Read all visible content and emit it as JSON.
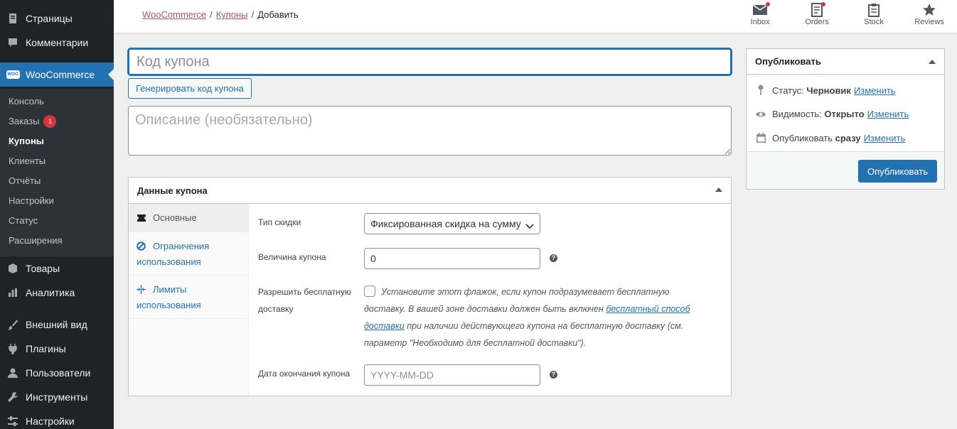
{
  "sidebar": {
    "top_items": [
      {
        "label": "Страницы",
        "icon": "pages-icon"
      },
      {
        "label": "Комментарии",
        "icon": "comments-icon"
      }
    ],
    "woo": {
      "label": "WooCommerce",
      "icon_text": "WOO"
    },
    "submenu": [
      {
        "label": "Консоль"
      },
      {
        "label": "Заказы",
        "badge": "1"
      },
      {
        "label": "Купоны"
      },
      {
        "label": "Клиенты"
      },
      {
        "label": "Отчёты"
      },
      {
        "label": "Настройки"
      },
      {
        "label": "Статус"
      },
      {
        "label": "Расширения"
      }
    ],
    "bottom_items": [
      {
        "label": "Товары"
      },
      {
        "label": "Аналитика"
      },
      {
        "label": "Внешний вид"
      },
      {
        "label": "Плагины"
      },
      {
        "label": "Пользователи"
      },
      {
        "label": "Инструменты"
      },
      {
        "label": "Настройки"
      }
    ]
  },
  "header": {
    "breadcrumb": [
      "WooCommerce",
      "Купоны",
      "Добавить"
    ],
    "activity": [
      "Inbox",
      "Orders",
      "Stock",
      "Reviews"
    ]
  },
  "coupon": {
    "code_placeholder": "Код купона",
    "generate_label": "Генерировать код купона",
    "desc_placeholder": "Описание (необязательно)"
  },
  "coupon_data": {
    "title": "Данные купона",
    "tabs": [
      "Основные",
      "Ограничения использования",
      "Лимиты использования"
    ],
    "discount_type_label": "Тип скидки",
    "discount_type_value": "Фиксированная скидка на сумму",
    "amount_label": "Величина купона",
    "amount_value": "0",
    "free_shipping_label": "Разрешить бесплатную доставку",
    "free_shipping_text_1": "Установите этот флажок, если купон подразумевает бесплатную доставку. В вашей зоне доставки должен быть включен",
    "free_shipping_link": "бесплатный способ доставки",
    "free_shipping_text_2": "при наличии действующего купона на бесплатную доставку (см. параметр \"Необходимо для бесплатной доставки\").",
    "expiry_label": "Дата окончания купона",
    "expiry_placeholder": "YYYY-MM-DD",
    "help_glyph": "?"
  },
  "publish": {
    "title": "Опубликовать",
    "status_label": "Статус:",
    "status_value": "Черновик",
    "visibility_label": "Видимость:",
    "visibility_value": "Открыто",
    "schedule_label": "Опубликовать",
    "schedule_value": "сразу",
    "edit_label": "Изменить",
    "publish_button": "Опубликовать"
  },
  "colors": {
    "accent": "#2271b1",
    "sidebar": "#1d2327",
    "badge": "#d63638",
    "breadcrumb_link": "#a7566d"
  }
}
